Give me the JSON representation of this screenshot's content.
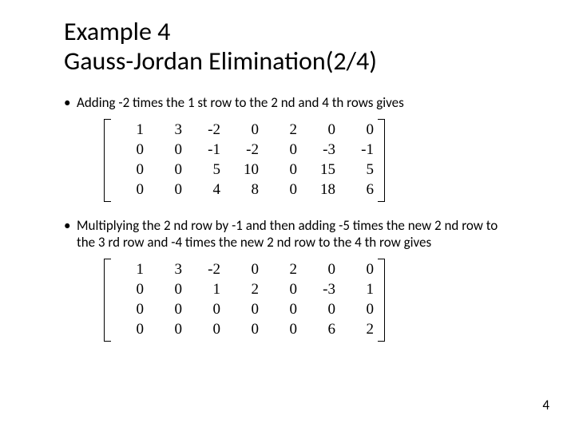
{
  "title_line1": "Example 4",
  "title_line2": "Gauss-Jordan Elimination(2/4)",
  "bullet1": "Adding -2 times the 1 st row to the 2 nd and 4 th rows gives",
  "bullet2": "Multiplying the 2 nd row by -1 and then adding -5 times the new 2 nd row to the 3 rd row and -4 times the new 2 nd row to the 4 th row gives",
  "page_number": "4",
  "chart_data": [
    {
      "type": "table",
      "title": "Matrix after step 1",
      "rows": [
        [
          1,
          3,
          -2,
          0,
          2,
          0,
          0
        ],
        [
          0,
          0,
          -1,
          -2,
          0,
          -3,
          -1
        ],
        [
          0,
          0,
          5,
          10,
          0,
          15,
          5
        ],
        [
          0,
          0,
          4,
          8,
          0,
          18,
          6
        ]
      ]
    },
    {
      "type": "table",
      "title": "Matrix after step 2",
      "rows": [
        [
          1,
          3,
          -2,
          0,
          2,
          0,
          0
        ],
        [
          0,
          0,
          1,
          2,
          0,
          -3,
          1
        ],
        [
          0,
          0,
          0,
          0,
          0,
          0,
          0
        ],
        [
          0,
          0,
          0,
          0,
          0,
          6,
          2
        ]
      ]
    }
  ],
  "m": {
    "a": {
      "r0c0": "1",
      "r0c1": "3",
      "r0c2": "-2",
      "r0c3": "0",
      "r0c4": "2",
      "r0c5": "0",
      "r0c6": "0",
      "r1c0": "0",
      "r1c1": "0",
      "r1c2": "-1",
      "r1c3": "-2",
      "r1c4": "0",
      "r1c5": "-3",
      "r1c6": "-1",
      "r2c0": "0",
      "r2c1": "0",
      "r2c2": "5",
      "r2c3": "10",
      "r2c4": "0",
      "r2c5": "15",
      "r2c6": "5",
      "r3c0": "0",
      "r3c1": "0",
      "r3c2": "4",
      "r3c3": "8",
      "r3c4": "0",
      "r3c5": "18",
      "r3c6": "6"
    },
    "b": {
      "r0c0": "1",
      "r0c1": "3",
      "r0c2": "-2",
      "r0c3": "0",
      "r0c4": "2",
      "r0c5": "0",
      "r0c6": "0",
      "r1c0": "0",
      "r1c1": "0",
      "r1c2": "1",
      "r1c3": "2",
      "r1c4": "0",
      "r1c5": "-3",
      "r1c6": "1",
      "r2c0": "0",
      "r2c1": "0",
      "r2c2": "0",
      "r2c3": "0",
      "r2c4": "0",
      "r2c5": "0",
      "r2c6": "0",
      "r3c0": "0",
      "r3c1": "0",
      "r3c2": "0",
      "r3c3": "0",
      "r3c4": "0",
      "r3c5": "6",
      "r3c6": "2"
    }
  }
}
